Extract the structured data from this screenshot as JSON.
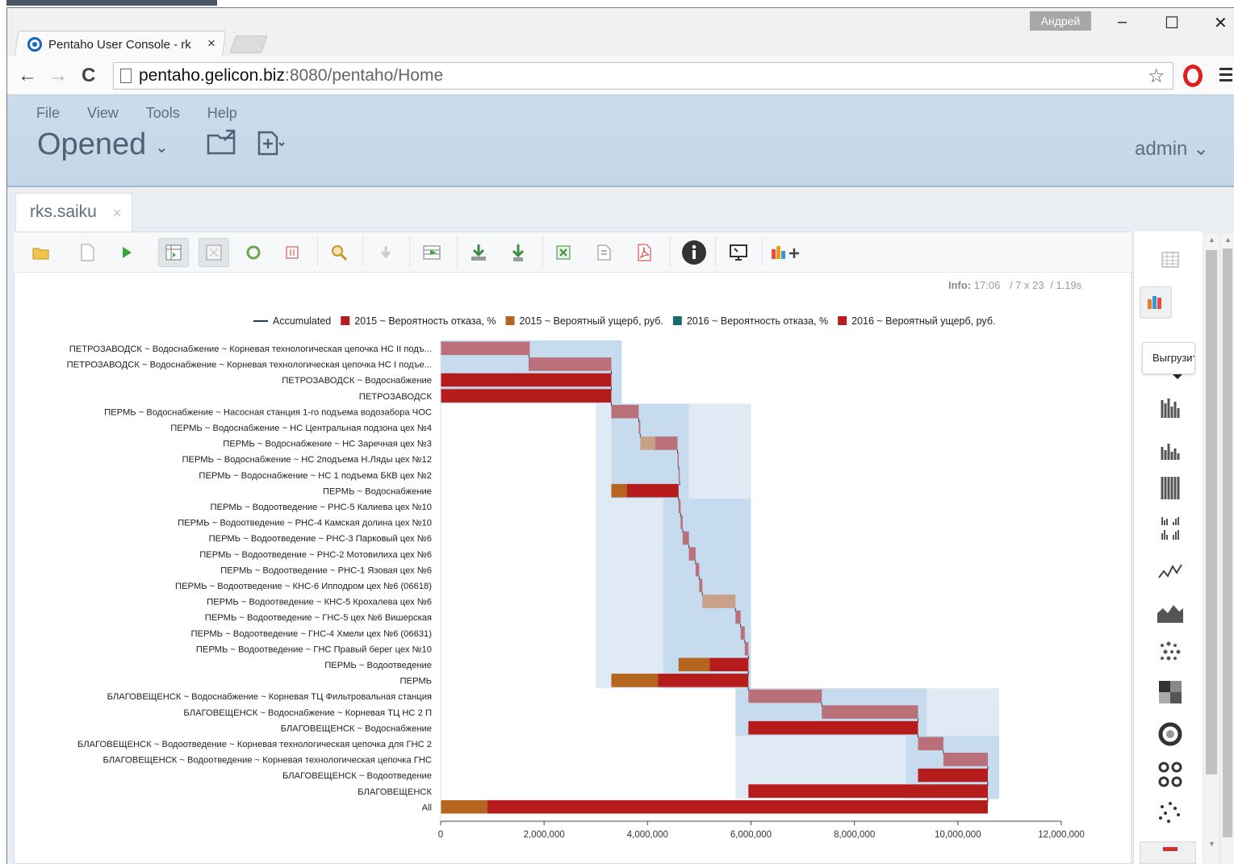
{
  "browser": {
    "tab_title": "Pentaho User Console - rk",
    "tab_close": "×",
    "user": "Андрей",
    "url_host": "pentaho.gelicon.biz",
    "url_path": ":8080/pentaho/Home",
    "min": "–",
    "max": "☐",
    "close": "✕",
    "back": "←",
    "forward": "→",
    "reload": "C",
    "star": "☆"
  },
  "app": {
    "menu": [
      "File",
      "View",
      "Tools",
      "Help"
    ],
    "perspective": "Opened",
    "chev": "⌄",
    "user": "admin ⌄",
    "doc_tab": "rks.saiku",
    "doc_tab_close": "×",
    "info_label": "Info:",
    "info_value": "17:06",
    "info_dims": "/ 7 x 23",
    "info_time": "/ 1.19s",
    "export_label": "Выгрузит",
    "icons": {
      "toolbar": [
        "open-query-icon",
        "new-query-icon",
        "run-query-icon",
        "toggle-fields-icon",
        "toggle-sidebar-icon",
        "automatic-execution-icon",
        "toggle-grand-total-icon",
        "drill-through-icon",
        "zoom-mode-icon",
        "hide-parents-icon",
        "non-empty-icon",
        "swap-axis-icon",
        "show-mdx-icon",
        "export-xls-icon",
        "export-csv-icon",
        "export-pdf-icon",
        "info-icon",
        "fullscreen-icon",
        "add-chart-icon"
      ]
    }
  },
  "chart_data": {
    "type": "bar",
    "subtype": "waterfall-horizontal",
    "legend_position": "top",
    "legend": [
      {
        "name": "Accumulated",
        "color": "#1f3b5c",
        "kind": "line"
      },
      {
        "name": "2015 ~ Вероятность отказа, %",
        "color": "#b71c1c",
        "kind": "box"
      },
      {
        "name": "2015 ~ Вероятный ущерб, руб.",
        "color": "#b5651d",
        "kind": "box"
      },
      {
        "name": "2016 ~ Вероятность отказа, %",
        "color": "#1a6b6b",
        "kind": "box"
      },
      {
        "name": "2016 ~ Вероятный ущерб, руб.",
        "color": "#b71c1c",
        "kind": "box"
      }
    ],
    "xlim": [
      0,
      12000000
    ],
    "x_ticks": [
      "0",
      "2,000,000",
      "4,000,000",
      "6,000,000",
      "8,000,000",
      "10,000,000",
      "12,000,000"
    ],
    "x_tick_values": [
      0,
      2000000,
      4000000,
      6000000,
      8000000,
      10000000,
      12000000
    ],
    "categories": [
      "ПЕТРОЗАВОДСК ~ Водоснабжение ~ Корневая технологическая цепочка НС II подъ...",
      "ПЕТРОЗАВОДСК ~ Водоснабжение ~ Корневая технологическая цепочка НС I подъе...",
      "ПЕТРОЗАВОДСК ~ Водоснабжение",
      "ПЕТРОЗАВОДСК",
      "ПЕРМЬ ~ Водоснабжение ~ Насосная станция 1-го подъема водозабора ЧОС",
      "ПЕРМЬ ~ Водоснабжение ~ НС Центральная подзона цех №4",
      "ПЕРМЬ ~ Водоснабжение ~ НС Заречная цех №3",
      "ПЕРМЬ ~ Водоснабжение ~ НС 2подъема Н.Ляды цех №12",
      "ПЕРМЬ ~ Водоснабжение ~ НС 1 подъема БКВ цех №2",
      "ПЕРМЬ ~ Водоснабжение",
      "ПЕРМЬ ~ Водоотведение ~ РНС-5 Калиева цех №10",
      "ПЕРМЬ ~ Водоотведение ~ РНС-4 Камская долина цех №10",
      "ПЕРМЬ ~ Водоотведение ~ РНС-3 Парковый цех №6",
      "ПЕРМЬ ~ Водоотведение ~ РНС-2 Мотовилиха цех №6",
      "ПЕРМЬ ~ Водоотведение ~ РНС-1 Язовая цех №6",
      "ПЕРМЬ ~ Водоотведение ~ КНС-6 Ипподром цех №6 (06618)",
      "ПЕРМЬ ~ Водоотведение ~ КНС-5 Крохалева цех №6",
      "ПЕРМЬ ~ Водоотведение ~ ГНС-5 цех №6 Вишерская",
      "ПЕРМЬ ~ Водоотведение ~ ГНС-4 Хмели цех №6 (06631)",
      "ПЕРМЬ ~ Водоотведение ~ ГНС Правый берег цех №10",
      "ПЕРМЬ ~ Водоотведение",
      "ПЕРМЬ",
      "БЛАГОВЕЩЕНСК ~ Водоснабжение ~ Корневая ТЦ Фильтровальная станция",
      "БЛАГОВЕЩЕНСК ~ Водоснабжение ~ Корневая ТЦ НС 2 П",
      "БЛАГОВЕЩЕНСК ~ Водоснабжение",
      "БЛАГОВЕЩЕНСК ~ Водоотведение ~ Корневая технологическая цепочка для ГНС 2",
      "БЛАГОВЕЩЕНСК ~ Водоотведение ~ Корневая технологическая цепочка ГНС",
      "БЛАГОВЕЩЕНСК ~ Водоотведение",
      "БЛАГОВЕЩЕНСК",
      "All"
    ],
    "bars": [
      [
        [
          0,
          1700000,
          "#b97079"
        ],
        [
          1700000,
          1710000,
          "#b97079"
        ]
      ],
      [
        [
          1700000,
          3300000,
          "#b97079"
        ]
      ],
      [
        [
          0,
          3300000,
          "#b71c1c"
        ]
      ],
      [
        [
          0,
          3300000,
          "#b71c1c"
        ]
      ],
      [
        [
          3300000,
          3830000,
          "#b97079"
        ]
      ],
      [
        [
          3830000,
          3860000,
          "#b97079"
        ]
      ],
      [
        [
          3860000,
          4150000,
          "#c8a088"
        ],
        [
          4150000,
          4580000,
          "#b97079"
        ]
      ],
      [
        [
          4580000,
          4600000,
          "#b97079"
        ]
      ],
      [
        [
          4600000,
          4620000,
          "#b97079"
        ]
      ],
      [
        [
          3300000,
          3600000,
          "#b5651d"
        ],
        [
          3600000,
          4600000,
          "#b71c1c"
        ]
      ],
      [
        [
          4600000,
          4640000,
          "#b97079"
        ]
      ],
      [
        [
          4640000,
          4680000,
          "#b97079"
        ]
      ],
      [
        [
          4680000,
          4800000,
          "#b97079"
        ]
      ],
      [
        [
          4800000,
          4930000,
          "#b97079"
        ]
      ],
      [
        [
          4930000,
          5000000,
          "#b97079"
        ]
      ],
      [
        [
          5000000,
          5060000,
          "#b97079"
        ]
      ],
      [
        [
          5060000,
          5700000,
          "#c8a088"
        ]
      ],
      [
        [
          5700000,
          5800000,
          "#b97079"
        ]
      ],
      [
        [
          5800000,
          5880000,
          "#b97079"
        ]
      ],
      [
        [
          5880000,
          5950000,
          "#b97079"
        ]
      ],
      [
        [
          4600000,
          5200000,
          "#b5651d"
        ],
        [
          5200000,
          5950000,
          "#b71c1c"
        ]
      ],
      [
        [
          3300000,
          4200000,
          "#b5651d"
        ],
        [
          4200000,
          5950000,
          "#b71c1c"
        ]
      ],
      [
        [
          5950000,
          7370000,
          "#b97079"
        ]
      ],
      [
        [
          7370000,
          9230000,
          "#b97079"
        ]
      ],
      [
        [
          5950000,
          9230000,
          "#b71c1c"
        ]
      ],
      [
        [
          9230000,
          9720000,
          "#b97079"
        ]
      ],
      [
        [
          9720000,
          10580000,
          "#b97079"
        ]
      ],
      [
        [
          9230000,
          10580000,
          "#b71c1c"
        ]
      ],
      [
        [
          5950000,
          10580000,
          "#b71c1c"
        ]
      ],
      [
        [
          0,
          900000,
          "#b5651d"
        ],
        [
          900000,
          10580000,
          "#b71c1c"
        ]
      ]
    ],
    "bands": [
      {
        "rows": [
          0,
          3
        ],
        "from": 0,
        "to": 3500000,
        "color": "#c6dcee"
      },
      {
        "rows": [
          4,
          9
        ],
        "from": 3000000,
        "to": 6000000,
        "color": "#dfeaf4"
      },
      {
        "rows": [
          4,
          9
        ],
        "from": 3300000,
        "to": 4800000,
        "color": "#c6dcee"
      },
      {
        "rows": [
          10,
          21
        ],
        "from": 3000000,
        "to": 6000000,
        "color": "#dfeaf4"
      },
      {
        "rows": [
          10,
          21
        ],
        "from": 4300000,
        "to": 6000000,
        "color": "#c6dcee"
      },
      {
        "rows": [
          22,
          28
        ],
        "from": 5700000,
        "to": 10800000,
        "color": "#dfeaf4"
      },
      {
        "rows": [
          22,
          24
        ],
        "from": 5700000,
        "to": 9400000,
        "color": "#c6dcee"
      },
      {
        "rows": [
          25,
          28
        ],
        "from": 9000000,
        "to": 10800000,
        "color": "#c6dcee"
      }
    ]
  }
}
